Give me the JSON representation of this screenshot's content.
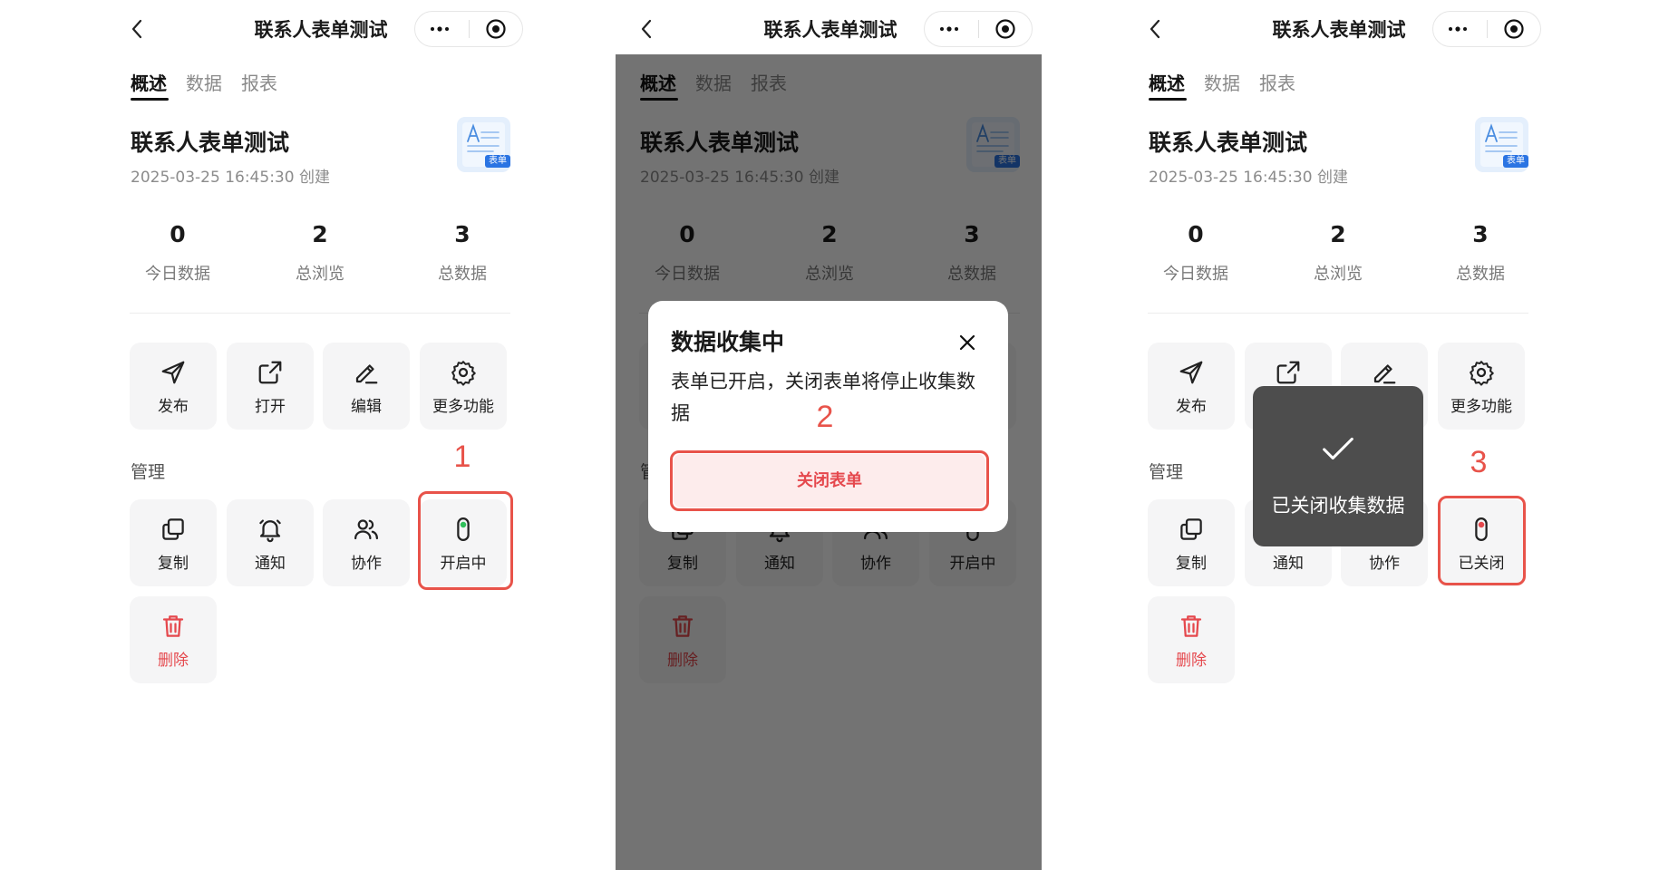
{
  "screen": {
    "nav_title": "联系人表单测试",
    "tabs": [
      "概述",
      "数据",
      "报表"
    ],
    "form": {
      "title": "联系人表单测试",
      "created": "2025-03-25 16:45:30 创建",
      "badge": "表单",
      "icon": "form-document-icon"
    },
    "stats": [
      {
        "value": "0",
        "label": "今日数据"
      },
      {
        "value": "2",
        "label": "总浏览"
      },
      {
        "value": "3",
        "label": "总数据"
      }
    ],
    "actions": [
      {
        "label": "发布",
        "icon": "send-icon"
      },
      {
        "label": "打开",
        "icon": "external-link-icon"
      },
      {
        "label": "编辑",
        "icon": "pencil-icon"
      },
      {
        "label": "更多功能",
        "icon": "gear-icon"
      }
    ],
    "manage_title": "管理",
    "manage": [
      {
        "label": "复制",
        "icon": "copy-icon"
      },
      {
        "label": "通知",
        "icon": "bell-icon"
      },
      {
        "label": "协作",
        "icon": "people-icon"
      }
    ],
    "delete": {
      "label": "删除",
      "icon": "trash-icon"
    }
  },
  "panels": [
    {
      "toggle": {
        "label": "开启中",
        "icon": "toggle-icon",
        "dot_color": "#2fbf5a"
      },
      "step_number": "1"
    },
    {
      "toggle": {
        "label": "开启中",
        "icon": "toggle-icon",
        "dot_color": "#2fbf5a"
      },
      "step_number": "2"
    },
    {
      "toggle": {
        "label": "已关闭",
        "icon": "toggle-icon",
        "dot_color": "#e5484d"
      },
      "step_number": "3"
    }
  ],
  "modal": {
    "title": "数据收集中",
    "body": "表单已开启，关闭表单将停止收集数据",
    "confirm_label": "关闭表单"
  },
  "toast": {
    "text": "已关闭收集数据",
    "icon": "check-icon"
  },
  "colors": {
    "annotation": "#e8534a",
    "danger": "#e5484d",
    "toast_bg": "#4d4d4d",
    "modal_button_bg": "#fdecec"
  }
}
